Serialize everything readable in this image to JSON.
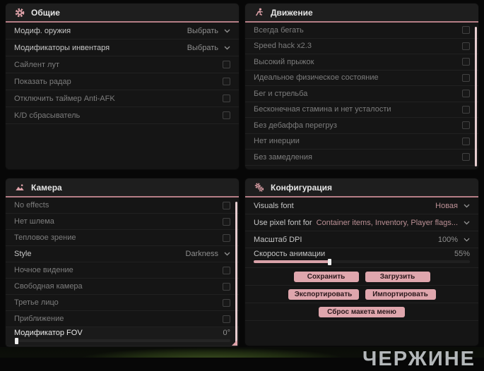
{
  "colors": {
    "accent_pink": "#dfa2a9",
    "header_underline": "#b57e86",
    "button_bg": "#dfa6ad",
    "button_text": "#2a181b",
    "scrollbar_pink": "#e7cdd0",
    "slider_fill": "#d9a2a9",
    "panel_bg": "#151515"
  },
  "watermark": "ЧЕРЖИНЕ",
  "panels": {
    "general": {
      "title": "Общие",
      "icon": "gear-icon",
      "rows": [
        {
          "label": "Модиф. оружия",
          "control": "select",
          "value": "Выбрать"
        },
        {
          "label": "Модификаторы инвентаря",
          "control": "select",
          "value": "Выбрать"
        },
        {
          "label": "Сайлент лут",
          "control": "checkbox",
          "checked": false
        },
        {
          "label": "Показать радар",
          "control": "checkbox",
          "checked": false
        },
        {
          "label": "Отключить таймер Anti-AFK",
          "control": "checkbox",
          "checked": false
        },
        {
          "label": "K/D сбрасыватель",
          "control": "checkbox",
          "checked": false
        }
      ]
    },
    "movement": {
      "title": "Движение",
      "icon": "runner-icon",
      "rows": [
        {
          "label": "Всегда бегать",
          "control": "checkbox",
          "checked": false
        },
        {
          "label": "Speed hack x2.3",
          "control": "checkbox",
          "checked": false
        },
        {
          "label": "Высокий прыжок",
          "control": "checkbox",
          "checked": false
        },
        {
          "label": "Идеальное физическое состояние",
          "control": "checkbox",
          "checked": false
        },
        {
          "label": "Бег и стрельба",
          "control": "checkbox",
          "checked": false
        },
        {
          "label": "Бесконечная стамина и нет усталости",
          "control": "checkbox",
          "checked": false
        },
        {
          "label": "Без дебаффа перегруз",
          "control": "checkbox",
          "checked": false
        },
        {
          "label": "Нет инерции",
          "control": "checkbox",
          "checked": false
        },
        {
          "label": "Без замедления",
          "control": "checkbox",
          "checked": false
        }
      ]
    },
    "camera": {
      "title": "Камера",
      "icon": "image-icon",
      "rows": [
        {
          "label": "No effects",
          "control": "checkbox",
          "checked": false
        },
        {
          "label": "Нет шлема",
          "control": "checkbox",
          "checked": false
        },
        {
          "label": "Тепловое зрение",
          "control": "checkbox",
          "checked": false
        },
        {
          "label": "Style",
          "control": "select",
          "value": "Darkness"
        },
        {
          "label": "Ночное видение",
          "control": "checkbox",
          "checked": false
        },
        {
          "label": "Свободная камера",
          "control": "checkbox",
          "checked": false
        },
        {
          "label": "Третье лицо",
          "control": "checkbox",
          "checked": false
        },
        {
          "label": "Приближение",
          "control": "checkbox",
          "checked": false
        }
      ],
      "fov_slider": {
        "label": "Модификатор FOV",
        "value": "0°",
        "percent": 0
      }
    },
    "config": {
      "title": "Конфигурация",
      "icon": "gears-icon",
      "rows": [
        {
          "label": "Visuals font",
          "control": "select",
          "value": "Новая"
        },
        {
          "label": "Use pixel font for",
          "control": "select",
          "value": "Container items, Inventory, Player flags..."
        },
        {
          "label": "Масштаб DPI",
          "control": "select",
          "value": "100%"
        }
      ],
      "anim_slider": {
        "label": "Скорость анимации",
        "value": "55%",
        "percent": 35
      },
      "buttons": {
        "save": "Сохранить",
        "load": "Загрузить",
        "export": "Экспортировать",
        "import": "Импортировать",
        "reset_layout": "Сброс макета меню"
      }
    }
  }
}
